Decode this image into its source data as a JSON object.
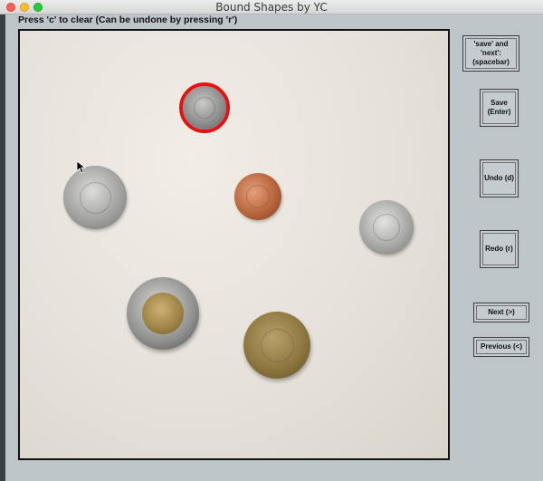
{
  "window": {
    "title": "Bound Shapes by YC"
  },
  "canvas": {
    "instruction": "Press 'c' to clear (Can be undone by pressing 'r')"
  },
  "sidebar": {
    "save_next_line1": "'save' and 'next':",
    "save_next_line2": "(spacebar)",
    "save_line1": "Save",
    "save_line2": "(Enter)",
    "undo": "Undo (d)",
    "redo": "Redo (r)",
    "next": "Next (>)",
    "previous": "Previous (<)"
  },
  "colors": {
    "bounding_circle": "#e41212",
    "window_background": "#bdc5c9"
  },
  "icons": [
    "close-window-icon",
    "minimize-window-icon",
    "maximize-window-icon",
    "mouse-cursor-icon"
  ]
}
